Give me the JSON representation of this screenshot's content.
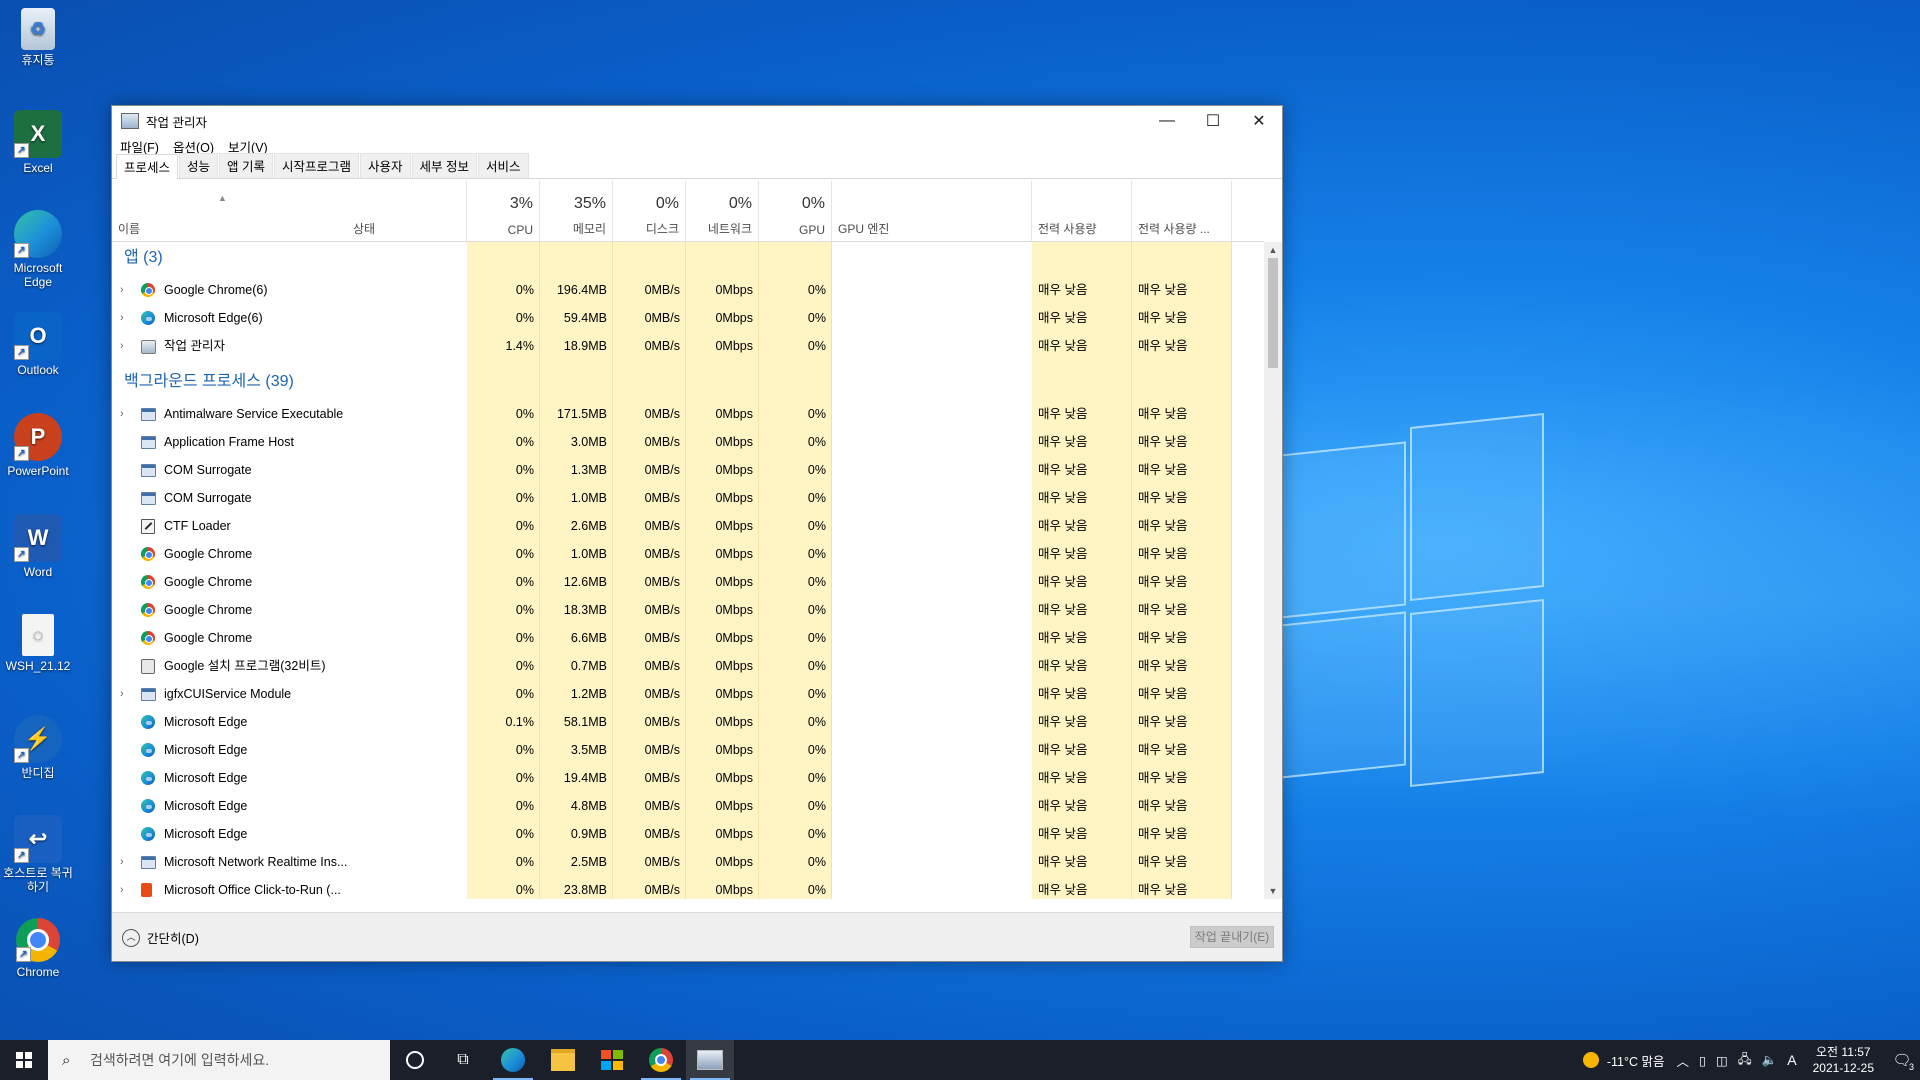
{
  "desktop": {
    "icons": [
      {
        "label": "휴지통",
        "icon": "recycle-bin-icon"
      },
      {
        "label": "Excel",
        "icon": "excel-icon",
        "color": "#1d6f42"
      },
      {
        "label": "Microsoft Edge",
        "icon": "edge-icon"
      },
      {
        "label": "Outlook",
        "icon": "outlook-icon",
        "color": "#0a64c8"
      },
      {
        "label": "PowerPoint",
        "icon": "powerpoint-icon",
        "color": "#c9401d"
      },
      {
        "label": "Word",
        "icon": "word-icon",
        "color": "#1e5ab4"
      },
      {
        "label": "WSH_21.12",
        "icon": "file-icon"
      },
      {
        "label": "반디집",
        "icon": "bandizip-icon"
      },
      {
        "label": "호스트로 복귀하기",
        "icon": "return-to-host-icon"
      },
      {
        "label": "Chrome",
        "icon": "chrome-icon"
      }
    ]
  },
  "window": {
    "title": "작업 관리자",
    "menu": [
      "파일(F)",
      "옵션(O)",
      "보기(V)"
    ],
    "tabs": [
      "프로세스",
      "성능",
      "앱 기록",
      "시작프로그램",
      "사용자",
      "세부 정보",
      "서비스"
    ],
    "active_tab": "프로세스"
  },
  "columns": {
    "name": "이름",
    "status": "상태",
    "cpu": {
      "pct": "3%",
      "label": "CPU"
    },
    "memory": {
      "pct": "35%",
      "label": "메모리"
    },
    "disk": {
      "pct": "0%",
      "label": "디스크"
    },
    "network": {
      "pct": "0%",
      "label": "네트워크"
    },
    "gpu": {
      "pct": "0%",
      "label": "GPU"
    },
    "gpu_engine": "GPU 엔진",
    "power": "전력 사용량",
    "power_trend": "전력 사용량 ..."
  },
  "groups": {
    "apps": "앱 (3)",
    "background": "백그라운드 프로세스 (39)"
  },
  "apps": [
    {
      "name": "Google Chrome(6)",
      "icon": "chrome",
      "expand": true,
      "cpu": "0%",
      "mem": "196.4MB",
      "disk": "0MB/s",
      "net": "0Mbps",
      "gpu": "0%",
      "power": "매우 낮음",
      "trend": "매우 낮음"
    },
    {
      "name": "Microsoft Edge(6)",
      "icon": "edge",
      "expand": true,
      "cpu": "0%",
      "mem": "59.4MB",
      "disk": "0MB/s",
      "net": "0Mbps",
      "gpu": "0%",
      "power": "매우 낮음",
      "trend": "매우 낮음"
    },
    {
      "name": "작업 관리자",
      "icon": "tm",
      "expand": true,
      "cpu": "1.4%",
      "mem": "18.9MB",
      "disk": "0MB/s",
      "net": "0Mbps",
      "gpu": "0%",
      "power": "매우 낮음",
      "trend": "매우 낮음"
    }
  ],
  "background": [
    {
      "name": "Antimalware Service Executable",
      "icon": "win",
      "expand": true,
      "cpu": "0%",
      "mem": "171.5MB",
      "disk": "0MB/s",
      "net": "0Mbps",
      "gpu": "0%",
      "power": "매우 낮음",
      "trend": "매우 낮음"
    },
    {
      "name": "Application Frame Host",
      "icon": "win",
      "expand": false,
      "cpu": "0%",
      "mem": "3.0MB",
      "disk": "0MB/s",
      "net": "0Mbps",
      "gpu": "0%",
      "power": "매우 낮음",
      "trend": "매우 낮음"
    },
    {
      "name": "COM Surrogate",
      "icon": "win",
      "expand": false,
      "cpu": "0%",
      "mem": "1.3MB",
      "disk": "0MB/s",
      "net": "0Mbps",
      "gpu": "0%",
      "power": "매우 낮음",
      "trend": "매우 낮음"
    },
    {
      "name": "COM Surrogate",
      "icon": "win",
      "expand": false,
      "cpu": "0%",
      "mem": "1.0MB",
      "disk": "0MB/s",
      "net": "0Mbps",
      "gpu": "0%",
      "power": "매우 낮음",
      "trend": "매우 낮음"
    },
    {
      "name": "CTF Loader",
      "icon": "ctf",
      "expand": false,
      "cpu": "0%",
      "mem": "2.6MB",
      "disk": "0MB/s",
      "net": "0Mbps",
      "gpu": "0%",
      "power": "매우 낮음",
      "trend": "매우 낮음"
    },
    {
      "name": "Google Chrome",
      "icon": "chrome",
      "expand": false,
      "cpu": "0%",
      "mem": "1.0MB",
      "disk": "0MB/s",
      "net": "0Mbps",
      "gpu": "0%",
      "power": "매우 낮음",
      "trend": "매우 낮음"
    },
    {
      "name": "Google Chrome",
      "icon": "chrome",
      "expand": false,
      "cpu": "0%",
      "mem": "12.6MB",
      "disk": "0MB/s",
      "net": "0Mbps",
      "gpu": "0%",
      "power": "매우 낮음",
      "trend": "매우 낮음"
    },
    {
      "name": "Google Chrome",
      "icon": "chrome",
      "expand": false,
      "cpu": "0%",
      "mem": "18.3MB",
      "disk": "0MB/s",
      "net": "0Mbps",
      "gpu": "0%",
      "power": "매우 낮음",
      "trend": "매우 낮음"
    },
    {
      "name": "Google Chrome",
      "icon": "chrome",
      "expand": false,
      "cpu": "0%",
      "mem": "6.6MB",
      "disk": "0MB/s",
      "net": "0Mbps",
      "gpu": "0%",
      "power": "매우 낮음",
      "trend": "매우 낮음"
    },
    {
      "name": "Google 설치 프로그램(32비트)",
      "icon": "inst",
      "expand": false,
      "cpu": "0%",
      "mem": "0.7MB",
      "disk": "0MB/s",
      "net": "0Mbps",
      "gpu": "0%",
      "power": "매우 낮음",
      "trend": "매우 낮음"
    },
    {
      "name": "igfxCUIService Module",
      "icon": "win",
      "expand": true,
      "cpu": "0%",
      "mem": "1.2MB",
      "disk": "0MB/s",
      "net": "0Mbps",
      "gpu": "0%",
      "power": "매우 낮음",
      "trend": "매우 낮음"
    },
    {
      "name": "Microsoft Edge",
      "icon": "edge",
      "expand": false,
      "cpu": "0.1%",
      "mem": "58.1MB",
      "disk": "0MB/s",
      "net": "0Mbps",
      "gpu": "0%",
      "power": "매우 낮음",
      "trend": "매우 낮음"
    },
    {
      "name": "Microsoft Edge",
      "icon": "edge",
      "expand": false,
      "cpu": "0%",
      "mem": "3.5MB",
      "disk": "0MB/s",
      "net": "0Mbps",
      "gpu": "0%",
      "power": "매우 낮음",
      "trend": "매우 낮음"
    },
    {
      "name": "Microsoft Edge",
      "icon": "edge",
      "expand": false,
      "cpu": "0%",
      "mem": "19.4MB",
      "disk": "0MB/s",
      "net": "0Mbps",
      "gpu": "0%",
      "power": "매우 낮음",
      "trend": "매우 낮음"
    },
    {
      "name": "Microsoft Edge",
      "icon": "edge",
      "expand": false,
      "cpu": "0%",
      "mem": "4.8MB",
      "disk": "0MB/s",
      "net": "0Mbps",
      "gpu": "0%",
      "power": "매우 낮음",
      "trend": "매우 낮음"
    },
    {
      "name": "Microsoft Edge",
      "icon": "edge",
      "expand": false,
      "cpu": "0%",
      "mem": "0.9MB",
      "disk": "0MB/s",
      "net": "0Mbps",
      "gpu": "0%",
      "power": "매우 낮음",
      "trend": "매우 낮음"
    },
    {
      "name": "Microsoft Network Realtime Ins...",
      "icon": "win",
      "expand": true,
      "cpu": "0%",
      "mem": "2.5MB",
      "disk": "0MB/s",
      "net": "0Mbps",
      "gpu": "0%",
      "power": "매우 낮음",
      "trend": "매우 낮음"
    },
    {
      "name": "Microsoft Office Click-to-Run (...",
      "icon": "office",
      "expand": true,
      "cpu": "0%",
      "mem": "23.8MB",
      "disk": "0MB/s",
      "net": "0Mbps",
      "gpu": "0%",
      "power": "매우 낮음",
      "trend": "매우 낮음"
    }
  ],
  "footer": {
    "fewer_details": "간단히(D)",
    "end_task": "작업 끝내기(E)"
  },
  "taskbar": {
    "search_placeholder": "검색하려면 여기에 입력하세요.",
    "weather": "-11°C 맑음",
    "ime": "A",
    "time": "오전 11:57",
    "date": "2021-12-25",
    "notification_count": "3"
  }
}
